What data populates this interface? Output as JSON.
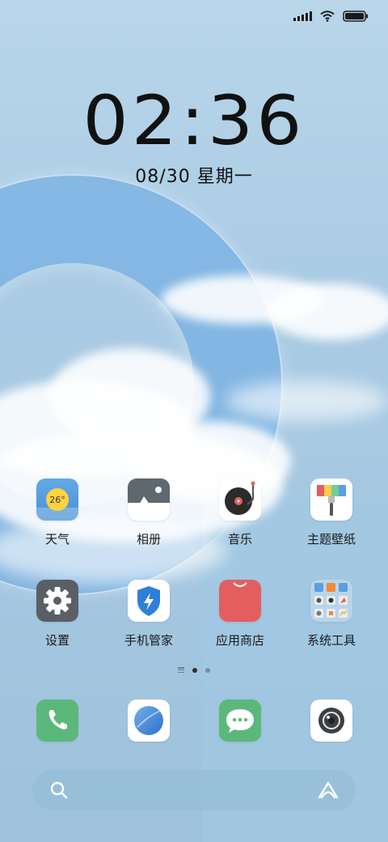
{
  "status_bar": {
    "signal_icon": "cellular-signal-icon",
    "wifi_icon": "wifi-icon",
    "battery_icon": "battery-icon",
    "battery_level": 1.0
  },
  "lockclock": {
    "time": "02:36",
    "date": "08/30 星期一"
  },
  "apps": [
    {
      "label": "天气",
      "icon": "weather-icon",
      "badge": "26°"
    },
    {
      "label": "相册",
      "icon": "gallery-icon"
    },
    {
      "label": "音乐",
      "icon": "music-icon"
    },
    {
      "label": "主题壁纸",
      "icon": "themes-icon"
    },
    {
      "label": "设置",
      "icon": "settings-icon"
    },
    {
      "label": "手机管家",
      "icon": "security-icon"
    },
    {
      "label": "应用商店",
      "icon": "app-store-icon"
    },
    {
      "label": "系统工具",
      "icon": "tools-folder-icon"
    }
  ],
  "page_indicator": {
    "pages": 2,
    "current": 1
  },
  "dock": [
    {
      "icon": "phone-icon"
    },
    {
      "icon": "browser-icon"
    },
    {
      "icon": "messages-icon"
    },
    {
      "icon": "camera-icon"
    }
  ],
  "search": {
    "icon": "search-icon",
    "assistant_icon": "assistant-icon"
  },
  "colors": {
    "weather_bg": "#5b9fde",
    "gallery_bg": "#5f6770",
    "store_bg": "#e35f5f",
    "settings_bg": "#5a5f66",
    "phone_bg": "#5cb87a",
    "messages_bg": "#5cb87a",
    "security_blue": "#2f7fd8"
  }
}
